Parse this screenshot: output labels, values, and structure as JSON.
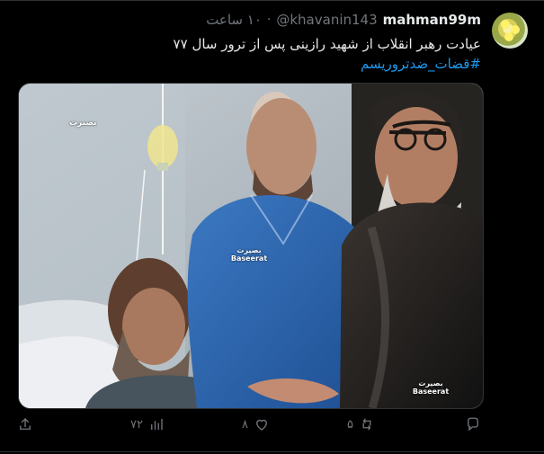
{
  "tweet": {
    "display_name": "mahman99m",
    "handle": "@khavanin143",
    "dot": "·",
    "time": "۱۰ ساعت",
    "text_line": "عیادت رهبر انقلاب از شهید رازینی پس از ترور سال ۷۷",
    "hashtag": "#قضات_ضدتروریسم"
  },
  "media": {
    "watermark_top": "بصیرت",
    "watermark_middle": "بصیرت Baseerat",
    "watermark_bottom": "بصیرت Baseerat"
  },
  "actions": {
    "reply_count": "",
    "retweet_count": "۵",
    "like_count": "۸",
    "views_count": "۷۲",
    "icons": [
      "comment-icon",
      "retweet-icon",
      "heart-icon",
      "chart-icon",
      "share-icon"
    ]
  },
  "colors": {
    "background": "#000000",
    "text": "#e7e9ea",
    "muted": "#71767b",
    "link": "#1d9bf0"
  }
}
